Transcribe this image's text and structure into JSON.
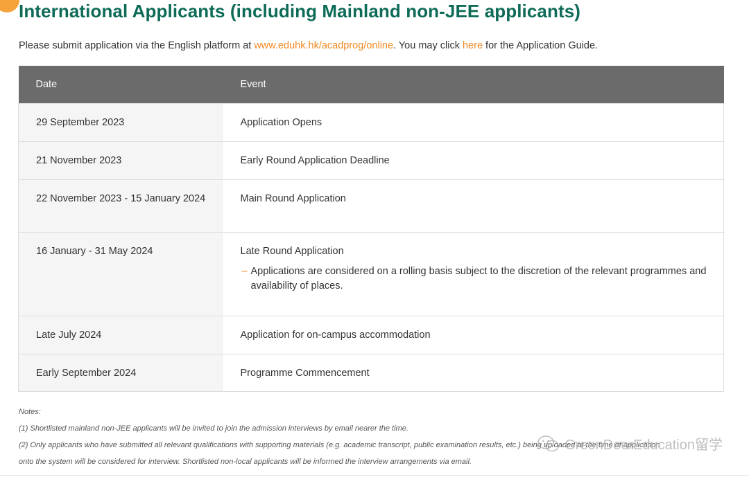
{
  "title": "International Applicants (including Mainland non-JEE applicants)",
  "intro": {
    "before_link": "Please submit application via the English platform at ",
    "link": "www.eduhk.hk/acadprog/online",
    "middle": ". You may click ",
    "here": "here",
    "after": " for the Application Guide."
  },
  "table": {
    "headers": [
      "Date",
      "Event"
    ],
    "rows": [
      {
        "date": "29 September 2023",
        "event": "Application Opens"
      },
      {
        "date": "21 November 2023",
        "event": "Early Round Application Deadline"
      },
      {
        "date": "22 November 2023 - 15 January 2024",
        "event": "Main Round Application"
      },
      {
        "date": "16 January - 31 May 2024",
        "event": "Late Round Application",
        "dash": "–",
        "note": "Applications are considered on a rolling basis subject to the discretion of the relevant programmes and availability of places."
      },
      {
        "date": "Late July 2024",
        "event": "Application for on-campus accommodation"
      },
      {
        "date": "Early September 2024",
        "event": "Programme Commencement"
      }
    ]
  },
  "notes": {
    "heading": "Notes:",
    "items": [
      "(1) Shortlisted mainland non-JEE applicants will be invited to join the admission interviews by email nearer the time.",
      "(2) Only applicants who have submitted all relevant qualifications with supporting materials (e.g. academic transcript, public examination results, etc.) being uploaded at the time of application",
      "onto the system will be considered for interview. Shortlisted non-local applicants will be informed the interview arrangements via email."
    ]
  },
  "watermark": {
    "text": "GreenDeerEducation留学",
    "icon": "wechat-icon"
  },
  "colors": {
    "title": "#0d6b57",
    "link": "#f08a24",
    "header_bg": "#6b6b6b",
    "accent_dot": "#f5a33a"
  }
}
